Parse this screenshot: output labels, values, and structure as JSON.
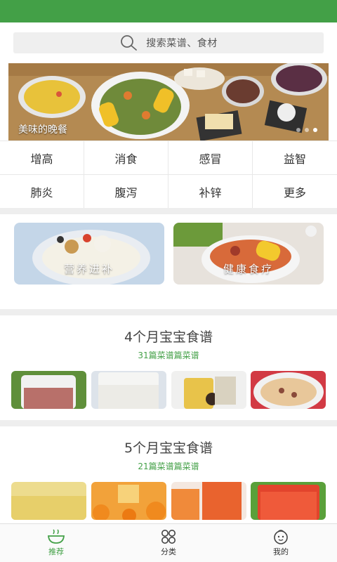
{
  "search": {
    "placeholder": "搜索菜谱、食材"
  },
  "banner": {
    "caption": "美味的晚餐",
    "slide_count": 3,
    "active_slide": 1
  },
  "categories": [
    {
      "label": "增高"
    },
    {
      "label": "消食"
    },
    {
      "label": "感冒"
    },
    {
      "label": "益智"
    },
    {
      "label": "肺炎"
    },
    {
      "label": "腹泻"
    },
    {
      "label": "补锌"
    },
    {
      "label": "更多"
    }
  ],
  "features": [
    {
      "label": "营养进补"
    },
    {
      "label": "健康食疗"
    }
  ],
  "sections": [
    {
      "title": "4个月宝宝食谱",
      "subtitle": "31篇菜谱篇菜谱"
    },
    {
      "title": "5个月宝宝食谱",
      "subtitle": "21篇菜谱篇菜谱"
    }
  ],
  "tabs": [
    {
      "label": "推荐",
      "icon": "bowl-icon",
      "active": true
    },
    {
      "label": "分类",
      "icon": "grid-icon",
      "active": false
    },
    {
      "label": "我的",
      "icon": "baby-face-icon",
      "active": false
    }
  ],
  "colors": {
    "accent": "#43a047",
    "status_bar": "#43a047"
  }
}
